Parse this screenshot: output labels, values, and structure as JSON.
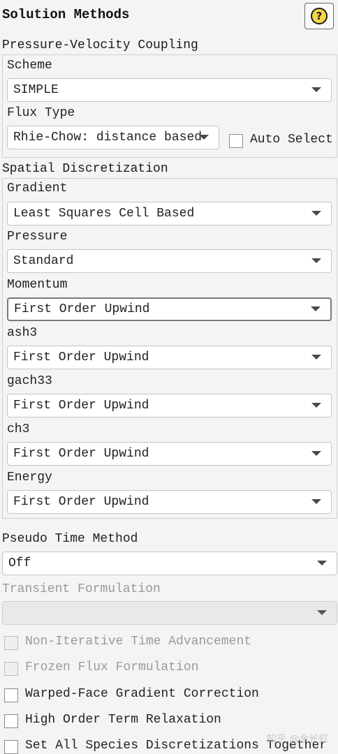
{
  "panel": {
    "title": "Solution Methods"
  },
  "help": {
    "symbol": "?"
  },
  "pressure_velocity": {
    "section_label": "Pressure-Velocity Coupling",
    "scheme_label": "Scheme",
    "scheme_value": "SIMPLE",
    "flux_type_label": "Flux Type",
    "flux_type_value": "Rhie-Chow: distance based",
    "auto_select_label": "Auto Select",
    "auto_select_checked": false
  },
  "spatial": {
    "section_label": "Spatial Discretization",
    "fields": [
      {
        "label": "Gradient",
        "value": "Least Squares Cell Based"
      },
      {
        "label": "Pressure",
        "value": "Standard"
      },
      {
        "label": "Momentum",
        "value": "First Order Upwind"
      },
      {
        "label": "ash3",
        "value": "First Order Upwind"
      },
      {
        "label": "gach33",
        "value": "First Order Upwind"
      },
      {
        "label": "ch3",
        "value": "First Order Upwind"
      },
      {
        "label": "Energy",
        "value": "First Order Upwind"
      }
    ]
  },
  "pseudo_time": {
    "label": "Pseudo Time Method",
    "value": "Off"
  },
  "transient": {
    "label": "Transient Formulation",
    "value": ""
  },
  "options": [
    {
      "label": "Non-Iterative Time Advancement",
      "checked": false,
      "enabled": false
    },
    {
      "label": "Frozen Flux Formulation",
      "checked": false,
      "enabled": false
    },
    {
      "label": "Warped-Face Gradient Correction",
      "checked": false,
      "enabled": true
    },
    {
      "label": "High Order Term Relaxation",
      "checked": false,
      "enabled": true
    },
    {
      "label": "Set All Species Discretizations Together",
      "checked": false,
      "enabled": true
    }
  ],
  "watermark": "知乎 @余长虹"
}
